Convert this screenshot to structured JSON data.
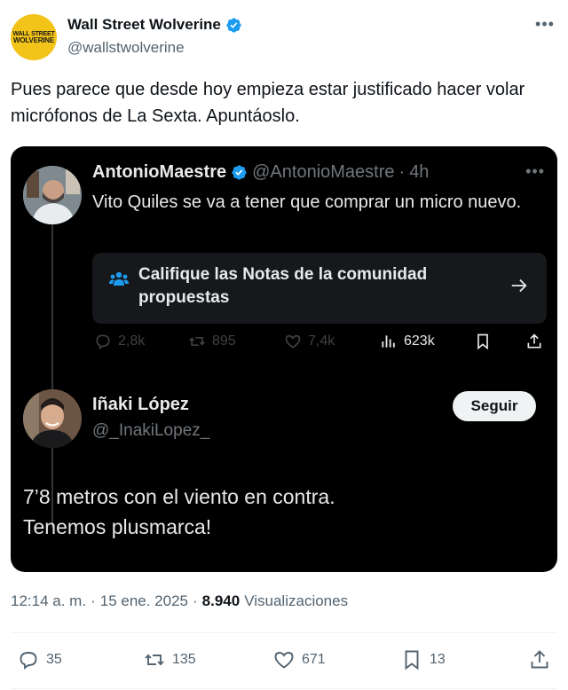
{
  "author": {
    "display_name": "Wall Street Wolverine",
    "handle": "@wallstwolverine",
    "avatar_text_line1": "WALL STREET",
    "avatar_text_line2": "WOLVERINE"
  },
  "tweet_text": "Pues parece que desde hoy empieza estar justificado hacer volar micrófonos de La Sexta. Apuntáoslo.",
  "quoted": {
    "display_name": "AntonioMaestre",
    "handle": "@AntonioMaestre",
    "separator": "·",
    "time": "4h",
    "text": "Vito Quiles se va a tener que comprar un micro nuevo.",
    "community_notes_label": "Califique las Notas de la comunidad propuestas",
    "replies": "2,8k",
    "reposts": "895",
    "likes": "7,4k",
    "views": "623k"
  },
  "reply": {
    "display_name": "Iñaki López",
    "handle": "@_InakiLopez_",
    "follow_label": "Seguir",
    "text_line1": "7’8 metros con el viento en contra.",
    "text_line2": "Tenemos plusmarca!"
  },
  "meta": {
    "time": "12:14 a. m.",
    "sep1": "·",
    "date": "15 ene. 2025",
    "sep2": "·",
    "views_count": "8.940",
    "views_label": "Visualizaciones"
  },
  "actions": {
    "replies": "35",
    "reposts": "135",
    "likes": "671",
    "bookmarks": "13"
  },
  "colors": {
    "verified": "#1d9bf0",
    "avatar_bg": "#f2c318",
    "card_bg": "#000000",
    "notes_bg": "#16181c"
  }
}
